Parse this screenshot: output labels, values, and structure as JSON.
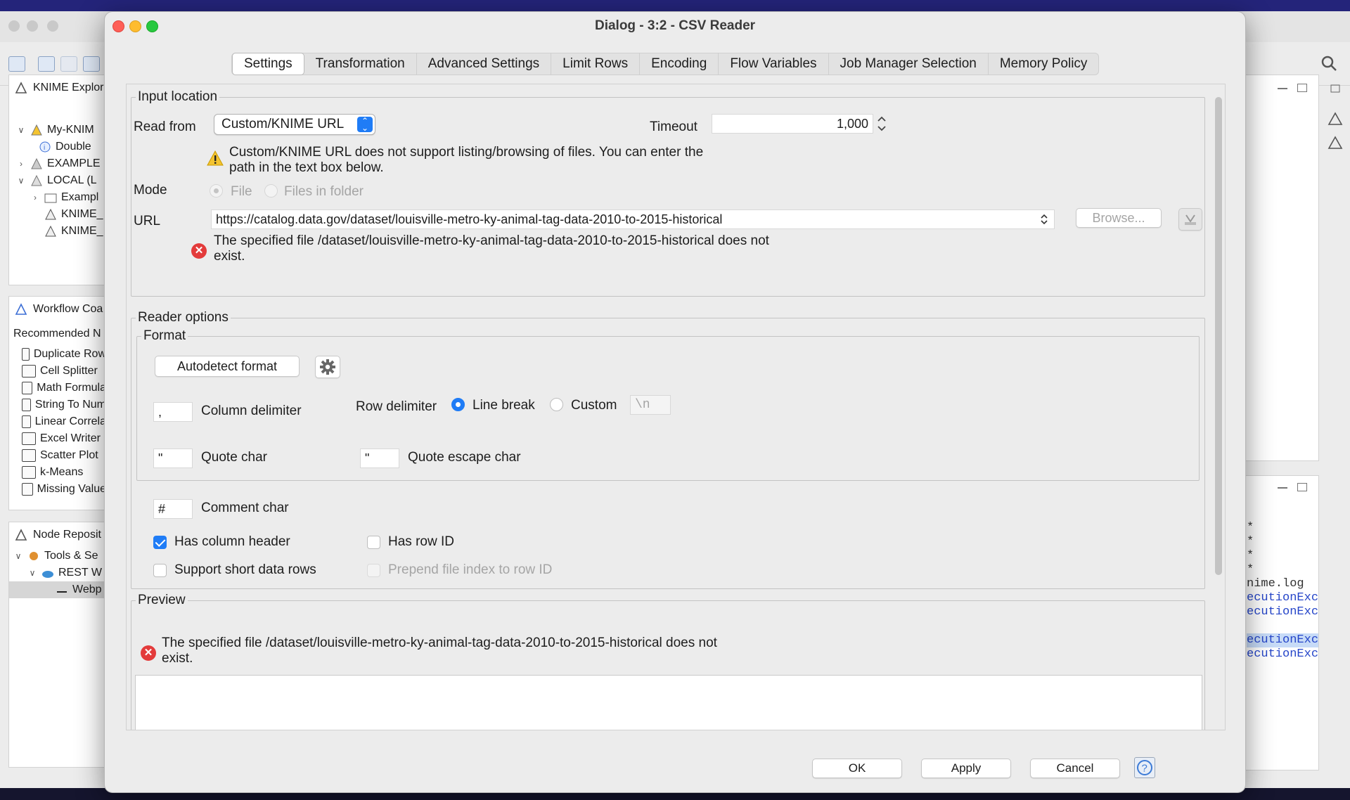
{
  "background_app": {
    "explorer": {
      "title": "KNIME Explor",
      "tree": [
        "My-KNIM",
        "Double",
        "EXAMPLE",
        "LOCAL (L",
        "Exampl",
        "KNIME_",
        "KNIME_"
      ]
    },
    "workflow_coach": {
      "title": "Workflow Coa",
      "subtitle": "Recommended N",
      "items": [
        {
          "icon": "duplicate-row-icon",
          "label": "Duplicate Row"
        },
        {
          "icon": "cell-splitter-icon",
          "label": "Cell Splitter"
        },
        {
          "icon": "math-formula-icon",
          "label": "Math Formula"
        },
        {
          "icon": "string-to-number-icon",
          "label": "String To Num"
        },
        {
          "icon": "linear-correlation-icon",
          "label": "Linear Correla"
        },
        {
          "icon": "excel-writer-icon",
          "label": "Excel Writer"
        },
        {
          "icon": "scatter-plot-icon",
          "label": "Scatter Plot"
        },
        {
          "icon": "k-means-icon",
          "label": "k-Means"
        },
        {
          "icon": "missing-value-icon",
          "label": "Missing Value"
        }
      ]
    },
    "node_repository": {
      "title": "Node Reposit",
      "tree": [
        "Tools & Se",
        "REST W",
        "Webp"
      ]
    },
    "console": {
      "lines": [
        "*",
        "*",
        "*",
        "*",
        "nime.log",
        "ecutionExc",
        "ecutionExc",
        "",
        "ecutionExc",
        "ecutionExc"
      ]
    }
  },
  "dialog": {
    "title": "Dialog - 3:2 - CSV Reader",
    "tabs": [
      "Settings",
      "Transformation",
      "Advanced Settings",
      "Limit Rows",
      "Encoding",
      "Flow Variables",
      "Job Manager Selection",
      "Memory Policy"
    ],
    "active_tab": "Settings",
    "input_location": {
      "legend": "Input location",
      "read_from_label": "Read from",
      "read_from_value": "Custom/KNIME URL",
      "timeout_label": "Timeout",
      "timeout_value": "1,000",
      "warning_line1": "Custom/KNIME URL does not support listing/browsing of files. You can enter the",
      "warning_line2": "path in the text box below.",
      "mode_label": "Mode",
      "mode_file": "File",
      "mode_folder": "Files in folder",
      "url_label": "URL",
      "url_value": "https://catalog.data.gov/dataset/louisville-metro-ky-animal-tag-data-2010-to-2015-historical",
      "browse_label": "Browse...",
      "error_line1": "The specified file /dataset/louisville-metro-ky-animal-tag-data-2010-to-2015-historical does not",
      "error_line2": "exist."
    },
    "reader_options": {
      "legend": "Reader options",
      "format_legend": "Format",
      "autodetect_label": "Autodetect format",
      "column_delimiter_value": ",",
      "column_delimiter_label": "Column delimiter",
      "row_delimiter_label": "Row delimiter",
      "line_break_label": "Line break",
      "custom_label": "Custom",
      "custom_value": "\\n",
      "quote_char_value": "\"",
      "quote_char_label": "Quote char",
      "quote_escape_value": "\"",
      "quote_escape_label": "Quote escape char",
      "comment_char_value": "#",
      "comment_char_label": "Comment char",
      "has_column_header_label": "Has column header",
      "has_column_header": true,
      "has_row_id_label": "Has row ID",
      "has_row_id": false,
      "support_short_rows_label": "Support short data rows",
      "support_short_rows": false,
      "prepend_index_label": "Prepend file index to row ID",
      "prepend_index": false
    },
    "preview": {
      "legend": "Preview",
      "error_line1": "The specified file /dataset/louisville-metro-ky-animal-tag-data-2010-to-2015-historical does not",
      "error_line2": "exist."
    },
    "footer": {
      "ok_label": "OK",
      "apply_label": "Apply",
      "cancel_label": "Cancel"
    }
  },
  "colors": {
    "accent": "#1f7cf6",
    "error": "#e33b3b",
    "warning": "#f4c430"
  }
}
